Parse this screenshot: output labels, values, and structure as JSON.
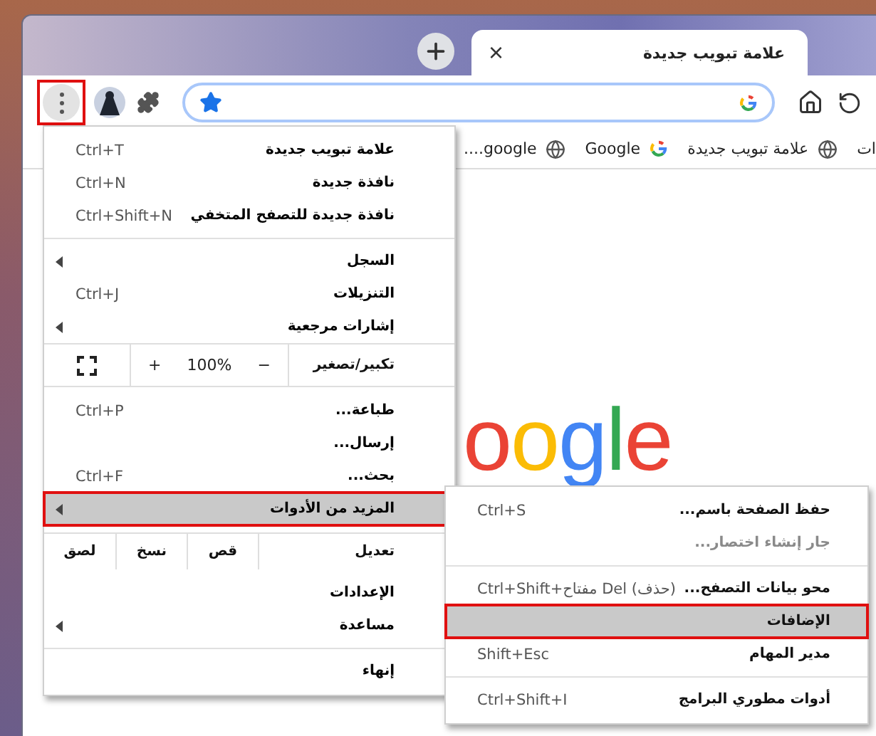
{
  "tab": {
    "title": "علامة تبويب جديدة",
    "close": "×",
    "selected": true
  },
  "toolbar": {
    "menu_selected": true
  },
  "bookmarks": [
    {
      "label": "ات",
      "kind": "plain"
    },
    {
      "label": "علامة تبويب جديدة",
      "kind": "folder"
    },
    {
      "label": "Google",
      "kind": "search"
    },
    {
      "label": "google....",
      "kind": "folder"
    }
  ],
  "logo": "oogle",
  "menu": [
    {
      "kind": "item",
      "label": "علامة تبويب جديدة",
      "shortcut": "Ctrl+T",
      "has_submenu": false,
      "selected": false
    },
    {
      "kind": "item",
      "label": "نافذة جديدة",
      "shortcut": "Ctrl+N",
      "has_submenu": false,
      "selected": false
    },
    {
      "kind": "item",
      "label": "نافذة جديدة للتصفح المتخفي",
      "shortcut": "Ctrl+Shift+N",
      "has_submenu": false,
      "selected": false
    },
    {
      "kind": "divider"
    },
    {
      "kind": "item",
      "label": "السجل",
      "has_submenu": true,
      "selected": false
    },
    {
      "kind": "item",
      "label": "التنزيلات",
      "shortcut": "Ctrl+J",
      "has_submenu": false,
      "selected": false
    },
    {
      "kind": "item",
      "label": "إشارات مرجعية",
      "has_submenu": true,
      "selected": false
    },
    {
      "kind": "zoom",
      "label": "تكبير/تصغير",
      "minus": "−",
      "value": "100%",
      "plus": "+"
    },
    {
      "kind": "item",
      "label": "طباعة...",
      "shortcut": "Ctrl+P",
      "has_submenu": false,
      "selected": false
    },
    {
      "kind": "item",
      "label": "إرسال...",
      "has_submenu": false,
      "selected": false
    },
    {
      "kind": "item",
      "label": "بحث...",
      "shortcut": "Ctrl+F",
      "has_submenu": false,
      "selected": false
    },
    {
      "kind": "item",
      "label": "المزيد من الأدوات",
      "has_submenu": true,
      "selected": true
    },
    {
      "kind": "edit",
      "label": "تعديل",
      "buttons": [
        "قص",
        "نسخ",
        "لصق"
      ]
    },
    {
      "kind": "item",
      "label": "الإعدادات",
      "has_submenu": false,
      "selected": false
    },
    {
      "kind": "item",
      "label": "مساعدة",
      "has_submenu": true,
      "selected": false
    },
    {
      "kind": "divider"
    },
    {
      "kind": "item",
      "label": "إنهاء",
      "has_submenu": false,
      "selected": false
    }
  ],
  "submenu": [
    {
      "kind": "item",
      "label": "حفظ الصفحة باسم...",
      "shortcut": "Ctrl+S",
      "selected": false,
      "disabled": false
    },
    {
      "kind": "item",
      "label": "جار إنشاء اختصار...",
      "selected": false,
      "disabled": true
    },
    {
      "kind": "divider"
    },
    {
      "kind": "item",
      "label": "محو بيانات التصفح...",
      "shortcut": "Ctrl+Shift+مفتاح Del (حذف)",
      "selected": false,
      "disabled": false
    },
    {
      "kind": "item",
      "label": "الإضافات",
      "selected": true,
      "disabled": false
    },
    {
      "kind": "item",
      "label": "مدير المهام",
      "shortcut": "Shift+Esc",
      "selected": false,
      "disabled": false
    },
    {
      "kind": "divider"
    },
    {
      "kind": "item",
      "label": "أدوات مطوري البرامج",
      "shortcut": "Ctrl+Shift+I",
      "selected": false,
      "disabled": false
    }
  ]
}
